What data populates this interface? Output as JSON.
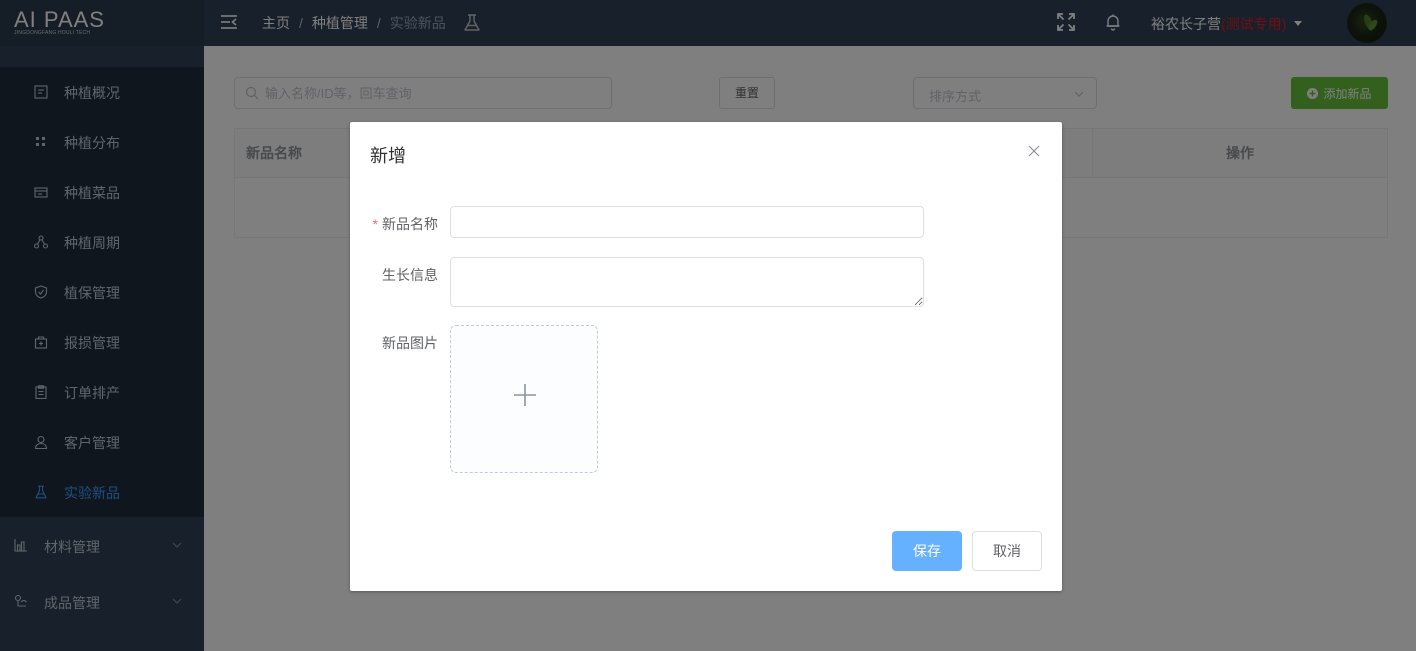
{
  "header": {
    "logo_main": "AI PAAS",
    "logo_sub": "JINGDONGFANG HOULI TECH",
    "breadcrumb": [
      "主页",
      "种植管理",
      "实验新品"
    ],
    "user_name": "裕农长子营",
    "user_tag": "(测试专用)",
    "icons": [
      "menu-fold-icon",
      "flask-icon",
      "fullscreen-icon",
      "bell-icon",
      "caret-down-icon",
      "avatar"
    ]
  },
  "sidebar": {
    "items": [
      {
        "label": "种植概况",
        "icon": "overview-icon"
      },
      {
        "label": "种植分布",
        "icon": "distribution-icon"
      },
      {
        "label": "种植菜品",
        "icon": "vegetable-icon"
      },
      {
        "label": "种植周期",
        "icon": "cycle-icon"
      },
      {
        "label": "植保管理",
        "icon": "shield-icon"
      },
      {
        "label": "报损管理",
        "icon": "loss-icon"
      },
      {
        "label": "订单排产",
        "icon": "clipboard-icon"
      },
      {
        "label": "客户管理",
        "icon": "user-icon"
      },
      {
        "label": "实验新品",
        "icon": "flask-icon",
        "active": true
      }
    ],
    "groups": [
      {
        "label": "材料管理",
        "icon": "chart-icon"
      },
      {
        "label": "成品管理",
        "icon": "product-icon"
      }
    ]
  },
  "toolbar": {
    "search_placeholder": "输入名称/ID等，回车查询",
    "reset_label": "重置",
    "sort_placeholder": "排序方式",
    "add_label": "添加新品"
  },
  "table": {
    "columns": [
      "新品名称",
      "操作"
    ]
  },
  "dialog": {
    "title": "新增",
    "name_label": "新品名称",
    "name_required": "*",
    "name_value": "",
    "growth_label": "生长信息",
    "growth_value": "",
    "image_label": "新品图片",
    "save_label": "保存",
    "cancel_label": "取消"
  },
  "colors": {
    "header_bg": "#304156",
    "submenu_bg": "#1f2d3d",
    "active": "#409eff",
    "add_button": "#67c23a",
    "save_button": "#66b1ff",
    "user_tag": "#e02020"
  }
}
